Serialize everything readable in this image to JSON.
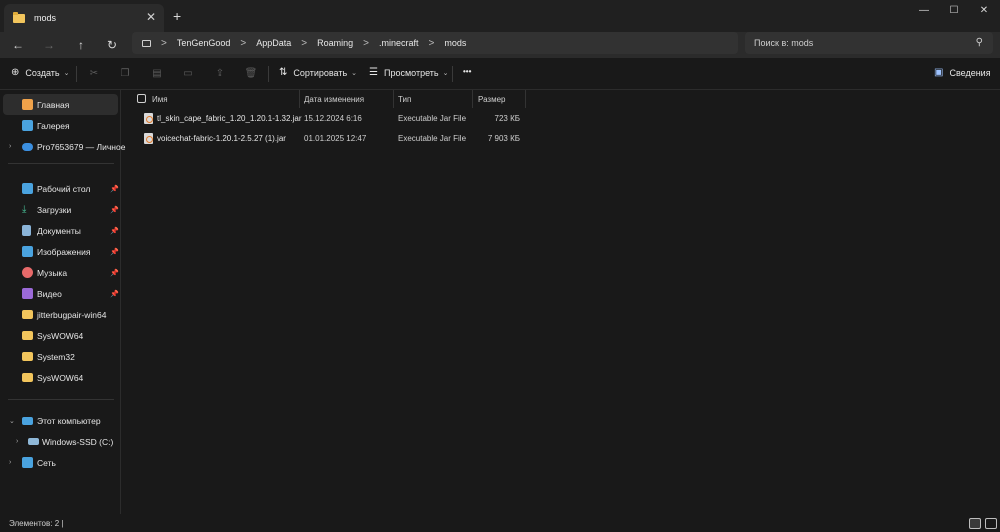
{
  "tab": {
    "title": "mods",
    "close": "✕",
    "new_tab": "+"
  },
  "window": {
    "minimize": "—",
    "maximize": "☐",
    "close": "✕"
  },
  "nav": {
    "back": "←",
    "forward": "→",
    "up": "↑",
    "refresh": "↻"
  },
  "address": {
    "segments": [
      "TenGenGood",
      "AppData",
      "Roaming",
      ".minecraft",
      "mods"
    ],
    "separator": ">"
  },
  "search": {
    "placeholder": "Поиск в: mods",
    "icon": "search-icon"
  },
  "toolbar": {
    "create": "Создать",
    "sort": "Сортировать",
    "view": "Просмотреть",
    "more": "•••",
    "details": "Сведения"
  },
  "sidebar": {
    "items": [
      {
        "label": "Главная",
        "icon": "home-icon",
        "color": "#f0a24a"
      },
      {
        "label": "Галерея",
        "icon": "gallery-icon",
        "color": "#4aa3df"
      },
      {
        "label": "Pro7653679 — Личное",
        "icon": "cloud-icon",
        "color": "#3b8fe0"
      },
      {
        "label": "Рабочий стол",
        "icon": "desktop-icon",
        "color": "#4aa3df"
      },
      {
        "label": "Загрузки",
        "icon": "download-icon",
        "color": "#4ac59b"
      },
      {
        "label": "Документы",
        "icon": "documents-icon",
        "color": "#8ab4d8"
      },
      {
        "label": "Изображения",
        "icon": "pictures-icon",
        "color": "#4aa3df"
      },
      {
        "label": "Музыка",
        "icon": "music-icon",
        "color": "#e86a6a"
      },
      {
        "label": "Видео",
        "icon": "video-icon",
        "color": "#9b6ad8"
      },
      {
        "label": "jitterbugpair-win64",
        "icon": "folder-icon",
        "color": "#f2c55c"
      },
      {
        "label": "SysWOW64",
        "icon": "folder-icon",
        "color": "#f2c55c"
      },
      {
        "label": "System32",
        "icon": "folder-icon",
        "color": "#f2c55c"
      },
      {
        "label": "SysWOW64",
        "icon": "folder-icon",
        "color": "#f2c55c"
      },
      {
        "label": "Этот компьютер",
        "icon": "computer-icon",
        "color": "#4aa3df"
      },
      {
        "label": "Windows-SSD (C:)",
        "icon": "drive-icon",
        "color": "#8fb8d8"
      },
      {
        "label": "Сеть",
        "icon": "network-icon",
        "color": "#4aa3df"
      }
    ]
  },
  "columns": {
    "name": "Имя",
    "date": "Дата изменения",
    "type": "Тип",
    "size": "Размер"
  },
  "files": [
    {
      "name": "tl_skin_cape_fabric_1.20_1.20.1-1.32.jar",
      "date": "15.12.2024 6:16",
      "type": "Executable Jar File",
      "size": "723 КБ"
    },
    {
      "name": "voicechat-fabric-1.20.1-2.5.27 (1).jar",
      "date": "01.01.2025 12:47",
      "type": "Executable Jar File",
      "size": "7 903 КБ"
    }
  ],
  "status": {
    "count": "Элементов: 2 |"
  }
}
